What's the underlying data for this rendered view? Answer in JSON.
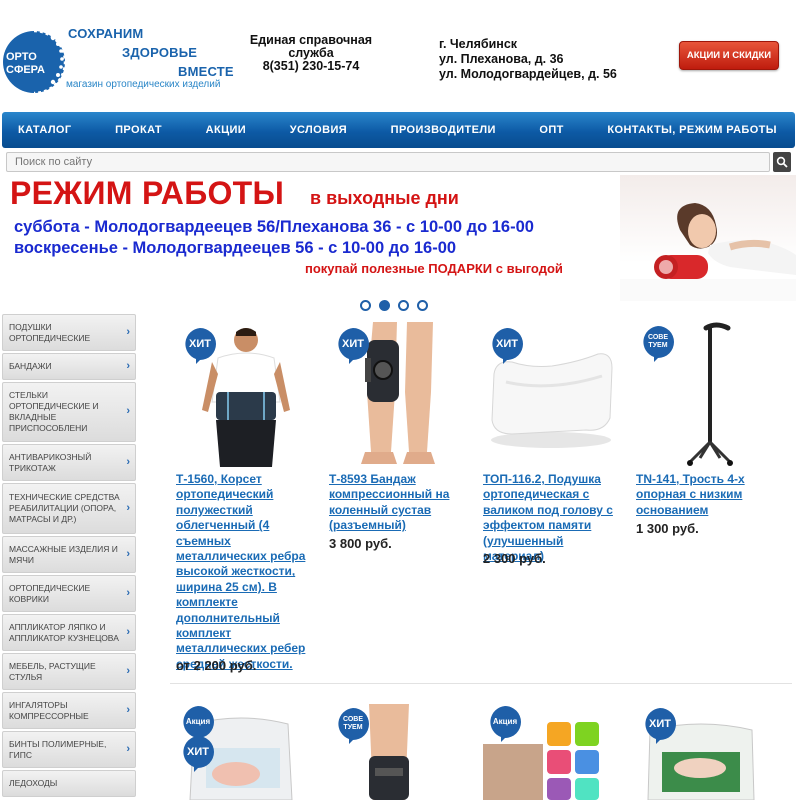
{
  "header": {
    "logo_text": [
      "ОРТО",
      "СФЕРА"
    ],
    "slogan": [
      "СОХРАНИМ",
      "ЗДОРОВЬЕ",
      "ВМЕСТЕ"
    ],
    "subtitle": "магазин ортопедических изделий",
    "help_title": "Единая справочная служба",
    "help_phone": "8(351) 230-15-74",
    "city": "г. Челябинск",
    "address1": "ул. Плеханова, д. 36",
    "address2": "ул. Молодогвардейцев, д. 56",
    "promo_button": "АКЦИИ И СКИДКИ"
  },
  "nav": [
    "КАТАЛОГ",
    "ПРОКАТ",
    "АКЦИИ",
    "УСЛОВИЯ",
    "ПРОИЗВОДИТЕЛИ",
    "ОПТ",
    "КОНТАКТЫ, РЕЖИМ РАБОТЫ"
  ],
  "search": {
    "placeholder": "Поиск по сайту"
  },
  "banner": {
    "title": "РЕЖИМ РАБОТЫ",
    "title_suffix": "в выходные дни",
    "saturday": "суббота       - Молодогвардеецев 56/Плеханова 36 - с 10-00 до 16-00",
    "sunday": "воскресенье - Молодогвардеецев 56 - с 10-00 до 16-00",
    "gift": "покупай полезные ПОДАРКИ с выгодой"
  },
  "slider": {
    "count": 4,
    "active": 1
  },
  "sidebar": [
    "ПОДУШКИ ОРТОПЕДИЧЕСКИЕ",
    "БАНДАЖИ",
    "СТЕЛЬКИ ОРТОПЕДИЧЕСКИЕ И ВКЛАДНЫЕ ПРИСПОСОБЛЕНИ",
    "АНТИВАРИКОЗНЫЙ ТРИКОТАЖ",
    "ТЕХНИЧЕСКИЕ СРЕДСТВА РЕАБИЛИТАЦИИ (ОПОРА, МАТРАСЫ И ДР.)",
    "МАССАЖНЫЕ ИЗДЕЛИЯ И МЯЧИ",
    "ОРТОПЕДИЧЕСКИЕ КОВРИКИ",
    "АППЛИКАТОР ЛЯПКО И АППЛИКАТОР КУЗНЕЦОВА",
    "МЕБЕЛЬ, РАСТУЩИЕ СТУЛЬЯ",
    "ИНГАЛЯТОРЫ КОМПРЕССОРНЫЕ",
    "БИНТЫ ПОЛИМЕРНЫЕ, ГИПС",
    "ЛЕДОХОДЫ"
  ],
  "products": [
    {
      "badge": "ХИТ",
      "title": "Т-1560, Корсет ортопедический полужесткий облегченный (4 съемных металлических ребра высокой жесткости, ширина 25 см). В комплекте дополнительный комплект металлических ребер средней жесткости.",
      "price": "от 2 200 руб."
    },
    {
      "badge": "ХИТ",
      "title": "Т-8593 Бандаж компрессионный на коленный сустав (разъемный)",
      "price": "3 800 руб."
    },
    {
      "badge": "ХИТ",
      "title": "ТОП-116.2, Подушка ортопедическая с валиком под голову с эффектом памяти (улучшенный материал)",
      "price": "2 300 руб."
    },
    {
      "badge": "СОВЕ ТУЕМ",
      "title": "TN-141, Трость 4-х опорная с низким основанием",
      "price": "1 300 руб."
    }
  ],
  "products_row2": [
    {
      "badges": [
        "Акция",
        "ХИТ"
      ]
    },
    {
      "badges": [
        "СОВЕ ТУЕМ"
      ]
    },
    {
      "badges": [
        "Акция"
      ]
    },
    {
      "badges": [
        "ХИТ"
      ]
    }
  ],
  "colors": {
    "brand_blue": "#0d5aa5",
    "link": "#1a6bb5",
    "banner_red": "#d41414",
    "banner_blue": "#1a2ad0",
    "promo_red": "#bf1c0e"
  }
}
